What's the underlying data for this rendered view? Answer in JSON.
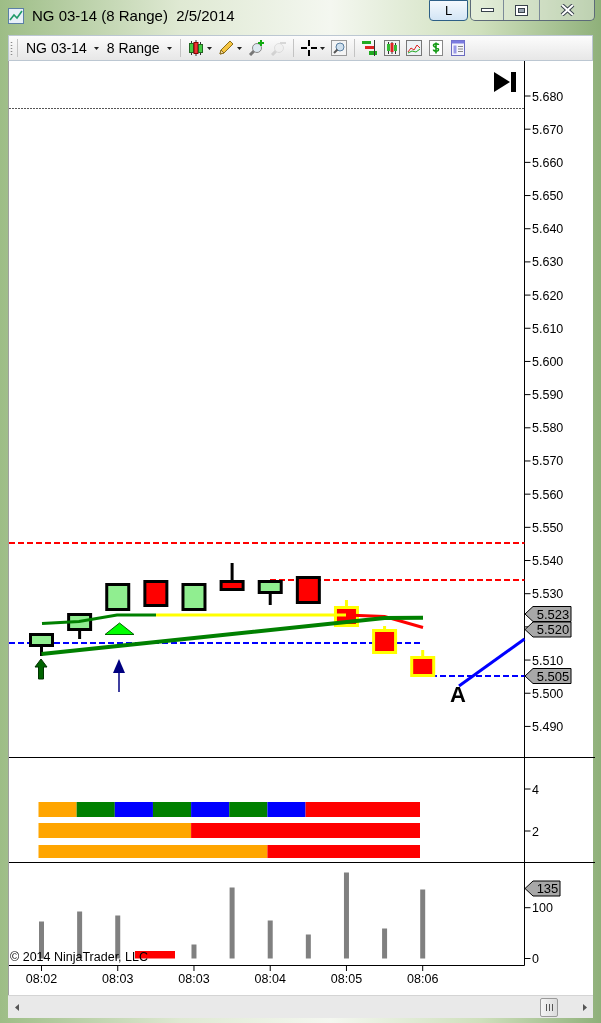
{
  "window": {
    "title": "NG 03-14 (8 Range)  2/5/2014",
    "title_button": "L"
  },
  "toolbar": {
    "instrument": "NG 03-14",
    "period": "8 Range",
    "tool_groups": [
      {
        "tools": [
          {
            "kind": "chart-style",
            "dropdown": true,
            "disabled": false
          },
          {
            "kind": "drawing",
            "dropdown": true,
            "disabled": false
          },
          {
            "kind": "zoom-in",
            "dropdown": false,
            "disabled": false
          },
          {
            "kind": "zoom-out",
            "dropdown": false,
            "disabled": true
          }
        ]
      },
      {
        "tools": [
          {
            "kind": "cursor",
            "dropdown": true,
            "disabled": false
          },
          {
            "kind": "zoom-box",
            "dropdown": false,
            "disabled": false
          }
        ]
      },
      {
        "tools": [
          {
            "kind": "strategies",
            "dropdown": false,
            "disabled": false
          },
          {
            "kind": "indicators",
            "dropdown": false,
            "disabled": false
          },
          {
            "kind": "chart-image",
            "dropdown": false,
            "disabled": false
          },
          {
            "kind": "dollar",
            "dropdown": false,
            "disabled": false
          },
          {
            "kind": "properties",
            "dropdown": false,
            "disabled": false
          }
        ]
      }
    ]
  },
  "price_panel": {
    "axis_labels": [
      "5.680",
      "5.670",
      "5.660",
      "5.650",
      "5.640",
      "5.630",
      "5.620",
      "5.610",
      "5.600",
      "5.590",
      "5.580",
      "5.570",
      "5.560",
      "5.550",
      "5.540",
      "5.530",
      "5.510",
      "5.500",
      "5.490"
    ],
    "candles": [
      {
        "kind": "up",
        "highlighted": false
      },
      {
        "kind": "up",
        "highlighted": false
      },
      {
        "kind": "up",
        "highlighted": false
      },
      {
        "kind": "down",
        "highlighted": false
      },
      {
        "kind": "up",
        "highlighted": false
      },
      {
        "kind": "down",
        "highlighted": false
      },
      {
        "kind": "up",
        "highlighted": false
      },
      {
        "kind": "down",
        "highlighted": false
      },
      {
        "kind": "down",
        "highlighted": true
      },
      {
        "kind": "down",
        "highlighted": true
      },
      {
        "kind": "down",
        "highlighted": true
      }
    ],
    "price_markers": [
      "5.523",
      "5.520",
      "5.505"
    ],
    "drawing_label": "A"
  },
  "indicator_panel": {
    "axis_labels": [
      "4",
      "2"
    ],
    "rows": [
      {
        "segments": [
          {
            "color": "#ffa500"
          },
          {
            "color": "#008000"
          },
          {
            "color": "#0000ff"
          },
          {
            "color": "#008000"
          },
          {
            "color": "#0000ff"
          },
          {
            "color": "#008000"
          },
          {
            "color": "#0000ff"
          },
          {
            "color": "#ff0000"
          },
          {
            "color": "#ff0000"
          },
          {
            "color": "#ff0000"
          }
        ]
      },
      {
        "segments": [
          {
            "color": "#ffa500"
          },
          {
            "color": "#ffa500"
          },
          {
            "color": "#ffa500"
          },
          {
            "color": "#ffa500"
          },
          {
            "color": "#ff0000"
          },
          {
            "color": "#ff0000"
          },
          {
            "color": "#ff0000"
          },
          {
            "color": "#ff0000"
          },
          {
            "color": "#ff0000"
          },
          {
            "color": "#ff0000"
          }
        ]
      },
      {
        "segments": [
          {
            "color": "#ffa500"
          },
          {
            "color": "#ffa500"
          },
          {
            "color": "#ffa500"
          },
          {
            "color": "#ffa500"
          },
          {
            "color": "#ffa500"
          },
          {
            "color": "#ffa500"
          },
          {
            "color": "#ff0000"
          },
          {
            "color": "#ff0000"
          },
          {
            "color": "#ff0000"
          },
          {
            "color": "#ff0000"
          }
        ]
      }
    ]
  },
  "volume_panel": {
    "axis_labels": [
      "100",
      "0"
    ],
    "time_labels": [
      "08:02",
      "08:03",
      "08:03",
      "08:04",
      "08:05",
      "08:06"
    ],
    "value_marker": "135",
    "copyright": "© 2014 NinjaTrader, LLC"
  }
}
